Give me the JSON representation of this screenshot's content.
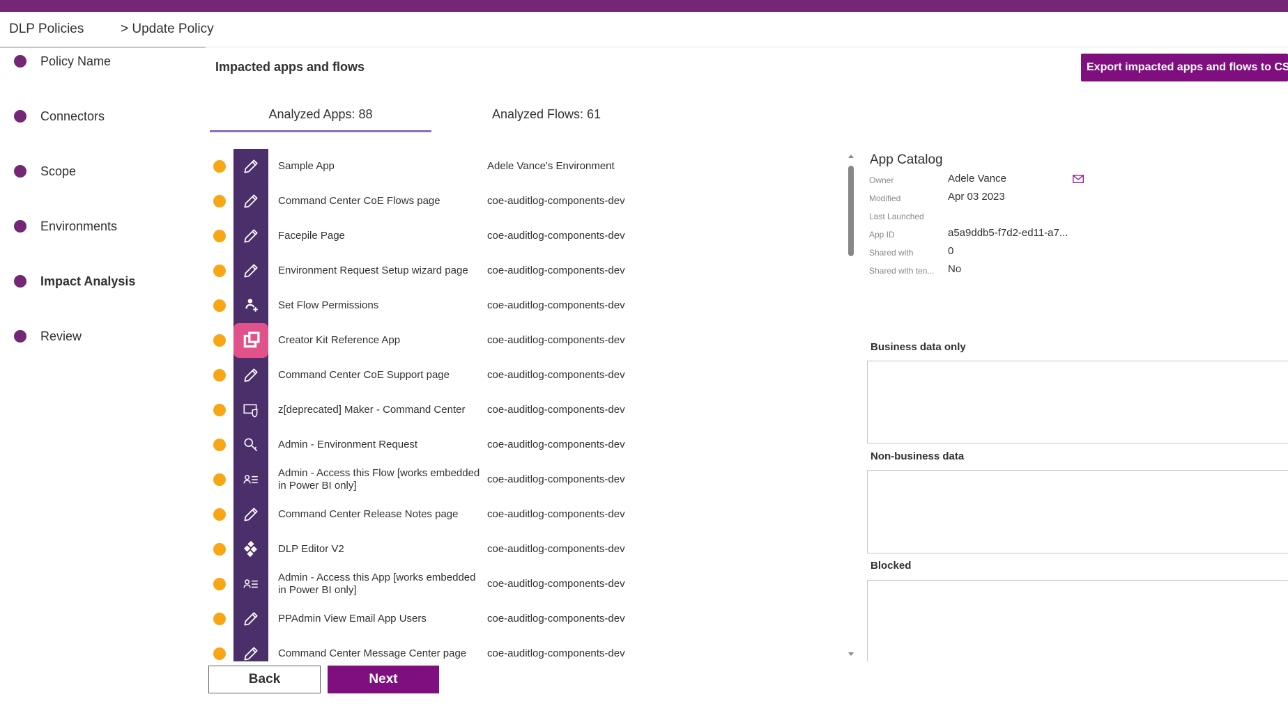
{
  "breadcrumb": {
    "root": "DLP Policies",
    "current": "> Update Policy"
  },
  "steps": [
    {
      "label": "Policy Name",
      "active": false
    },
    {
      "label": "Connectors",
      "active": false
    },
    {
      "label": "Scope",
      "active": false
    },
    {
      "label": "Environments",
      "active": false
    },
    {
      "label": "Impact Analysis",
      "active": true
    },
    {
      "label": "Review",
      "active": false
    }
  ],
  "main": {
    "title": "Impacted apps and flows",
    "export_label": "Export impacted apps and flows to CSV",
    "tabs": [
      {
        "label": "Analyzed Apps: 88",
        "selected": true
      },
      {
        "label": "Analyzed Flows: 61",
        "selected": false
      }
    ]
  },
  "apps": [
    {
      "name": "Sample App",
      "environment": "Adele Vance's Environment",
      "icon": "pencil-icon"
    },
    {
      "name": "Command Center CoE Flows page",
      "environment": "coe-auditlog-components-dev",
      "icon": "pencil-icon"
    },
    {
      "name": "Facepile Page",
      "environment": "coe-auditlog-components-dev",
      "icon": "pencil-icon"
    },
    {
      "name": "Environment Request Setup wizard page",
      "environment": "coe-auditlog-components-dev",
      "icon": "pencil-icon"
    },
    {
      "name": "Set Flow Permissions",
      "environment": "coe-auditlog-components-dev",
      "icon": "person-add-icon"
    },
    {
      "name": "Creator Kit Reference App",
      "environment": "coe-auditlog-components-dev",
      "icon": "creator-kit-icon"
    },
    {
      "name": "Command Center CoE Support page",
      "environment": "coe-auditlog-components-dev",
      "icon": "pencil-icon"
    },
    {
      "name": "z[deprecated] Maker - Command Center",
      "environment": "coe-auditlog-components-dev",
      "icon": "shield-screen-icon"
    },
    {
      "name": "Admin - Environment Request",
      "environment": "coe-auditlog-components-dev",
      "icon": "key-icon"
    },
    {
      "name": "Admin - Access this Flow [works embedded in Power BI only]",
      "environment": "coe-auditlog-components-dev",
      "icon": "contact-list-icon"
    },
    {
      "name": "Command Center Release Notes page",
      "environment": "coe-auditlog-components-dev",
      "icon": "pencil-icon"
    },
    {
      "name": "DLP Editor V2",
      "environment": "coe-auditlog-components-dev",
      "icon": "diamond-grid-icon"
    },
    {
      "name": "Admin - Access this App [works embedded in Power BI only]",
      "environment": "coe-auditlog-components-dev",
      "icon": "contact-list-icon"
    },
    {
      "name": "PPAdmin View Email App Users",
      "environment": "coe-auditlog-components-dev",
      "icon": "pencil-icon"
    },
    {
      "name": "Command Center Message Center page",
      "environment": "coe-auditlog-components-dev",
      "icon": "pencil-icon"
    }
  ],
  "detail": {
    "title": "App Catalog",
    "fields": [
      {
        "key": "Owner",
        "value": "Adele Vance"
      },
      {
        "key": "Modified",
        "value": "Apr 03 2023"
      },
      {
        "key": "Last Launched",
        "value": ""
      },
      {
        "key": "App ID",
        "value": "a5a9ddb5-f7d2-ed11-a7..."
      },
      {
        "key": "Shared with",
        "value": "0"
      },
      {
        "key": "Shared with ten...",
        "value": "No"
      }
    ],
    "zones": [
      {
        "label": "Business data only"
      },
      {
        "label": "Non-business data"
      },
      {
        "label": "Blocked"
      }
    ]
  },
  "footer": {
    "back_label": "Back",
    "next_label": "Next"
  },
  "colors": {
    "brand": "#742774",
    "button": "#7f0f7f",
    "status": "#f8a614",
    "icon_bg": "#4b2f6b",
    "accent_pink": "#e1518a"
  }
}
